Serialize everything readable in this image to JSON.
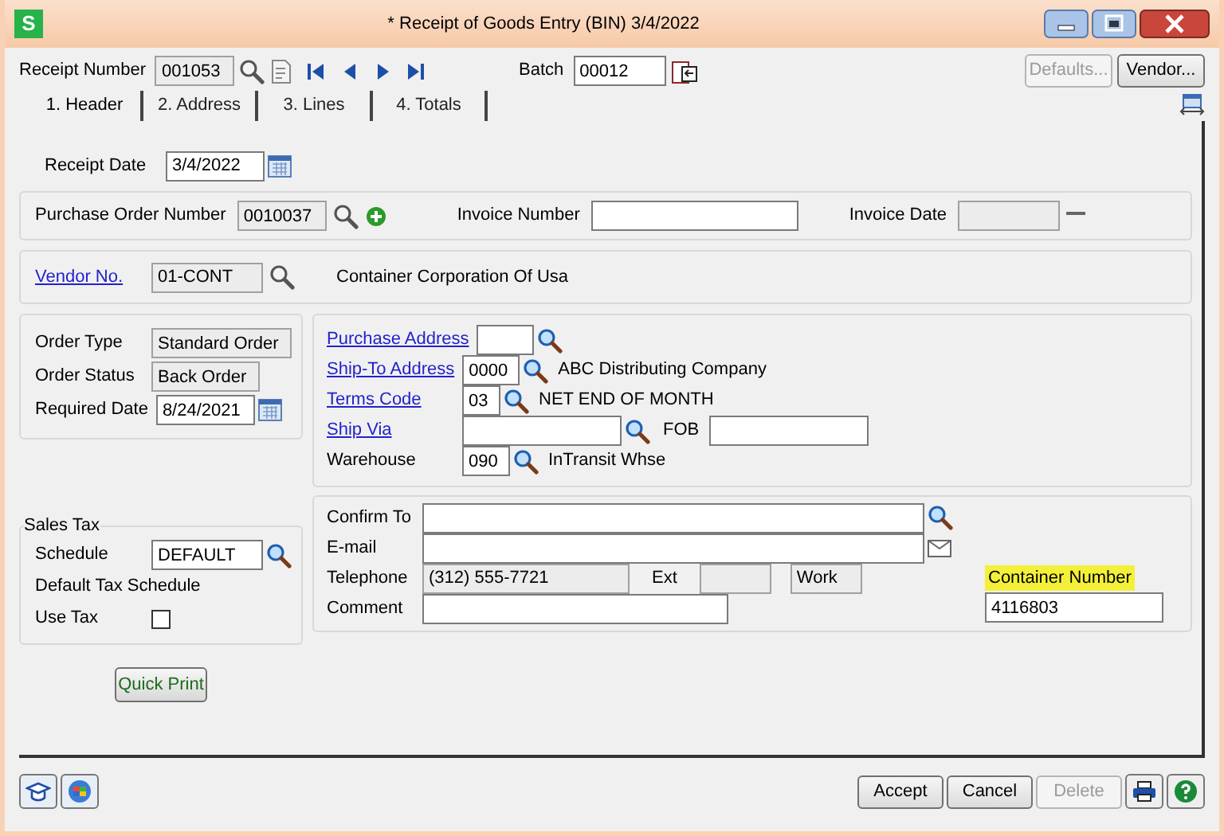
{
  "window": {
    "title": "* Receipt of Goods Entry (BIN) 3/4/2022",
    "app_icon": "S"
  },
  "toolbar": {
    "receipt_number": {
      "label": "Receipt Number",
      "value": "001053",
      "readonly": true
    },
    "batch": {
      "label": "Batch",
      "value": "00012",
      "readonly": false
    },
    "buttons": [
      {
        "label": "Defaults...",
        "disabled": true
      },
      {
        "label": "Vendor...",
        "disabled": false
      }
    ]
  },
  "tabs": [
    {
      "label": "1. Header",
      "selected": true
    },
    {
      "label": "2. Address",
      "selected": false
    },
    {
      "label": "3. Lines",
      "selected": false
    },
    {
      "label": "4. Totals",
      "selected": false
    }
  ],
  "receipt_date": {
    "label": "Receipt Date",
    "value": "3/4/2022",
    "readonly": false
  },
  "purchase_order": {
    "label": "Purchase Order Number",
    "value": "0010037",
    "readonly": true
  },
  "invoice_number": {
    "label": "Invoice Number",
    "readonly": false
  },
  "invoice_date": {
    "label": "Invoice Date",
    "readonly": true
  },
  "vendor": {
    "label": "Vendor No.",
    "value": "01-CONT",
    "readonly": true,
    "name": "Container Corporation Of Usa"
  },
  "order": [
    {
      "label": "Order Type",
      "value": "Standard Order",
      "readonly": true,
      "kind": "text"
    },
    {
      "label": "Order Status",
      "value": "Back Order",
      "readonly": true,
      "kind": "text"
    },
    {
      "label": "Required Date",
      "value": "8/24/2021",
      "readonly": false,
      "kind": "date"
    }
  ],
  "address": [
    {
      "label": "Purchase Address",
      "link": true,
      "readonly": false
    },
    {
      "label": "Ship-To Address",
      "link": true,
      "value": "0000",
      "readonly": false,
      "description": "ABC Distributing Company"
    },
    {
      "label": "Terms Code",
      "link": true,
      "value": "03",
      "readonly": false,
      "description": "NET END OF MONTH"
    },
    {
      "label": "Ship Via",
      "link": true,
      "readonly": false,
      "fob_label": "FOB"
    },
    {
      "label": "Warehouse",
      "link": false,
      "value": "090",
      "readonly": false,
      "description": "InTransit Whse"
    }
  ],
  "sales_tax": {
    "title": "Sales Tax",
    "schedule_label": "Schedule",
    "schedule": "DEFAULT",
    "description": "Default Tax Schedule",
    "use_tax_label": "Use Tax",
    "use_tax_checked": false
  },
  "contact": {
    "confirm_to": {
      "label": "Confirm To",
      "readonly": false
    },
    "email": {
      "label": "E-mail",
      "readonly": false
    },
    "telephone": {
      "label": "Telephone",
      "value": "(312) 555-7721",
      "readonly": true
    },
    "ext": {
      "label": "Ext",
      "readonly": true
    },
    "phone_type": {
      "value": "Work",
      "readonly": true
    },
    "comment": {
      "label": "Comment",
      "readonly": false
    },
    "container_number": {
      "label": "Container Number",
      "value": "4116803",
      "highlighted": true
    }
  },
  "quick_print": "Quick Print",
  "footer_buttons": [
    {
      "label": "Accept",
      "disabled": false
    },
    {
      "label": "Cancel",
      "disabled": false
    },
    {
      "label": "Delete",
      "disabled": true
    }
  ]
}
